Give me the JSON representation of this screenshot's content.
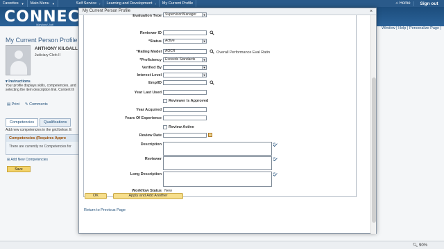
{
  "topnav": {
    "menus": [
      "Favorites",
      "Main Menu",
      "Self Service",
      "Learning and Development",
      "My Current Profile"
    ],
    "home": "Home",
    "signout": "Sign out"
  },
  "banner": {
    "logo": "CONNEC",
    "sub": "Maryland Judi"
  },
  "background": {
    "links": "Window | Help | Personalize Page |",
    "title": "My Current Person Profile",
    "name": "ANTHONY KILGALL",
    "job": "Judiciary Clerk II",
    "instructions_heading": "Instructions",
    "instructions_text": "Your profile displays skills, competencies, and selecting the item description link. Content th",
    "print": "Print",
    "comments": "Comments",
    "tabs": [
      "Competencies",
      "Qualifications"
    ],
    "help": "Add new competencies in the grid below. E",
    "section_heading": "Competencies (Requires Appro",
    "section_text": "There are currently no Competencies for",
    "add_link": "Add New Competencies",
    "save": "Save"
  },
  "statusbar": {
    "zoom": "90%"
  },
  "modal": {
    "title": "My Current Person Profile",
    "close": "×",
    "cut_label": "Evaluation Type",
    "cut_value": "Supervisor/Manager",
    "fields": {
      "reviewer_id_label": "Reviewer ID",
      "status_label": "*Status",
      "status_value": "Active",
      "rating_model_label": "*Rating Model",
      "rating_model_value": "AOCR",
      "rating_model_desc": "Overall Performance Eval Ratin",
      "proficiency_label": "*Proficiency",
      "proficiency_value": "Exceeds Standards",
      "verified_by_label": "Verified By",
      "verified_by_value": "",
      "interest_level_label": "Interest Level",
      "interest_level_value": "",
      "emplid_label": "EmplID",
      "emplid_value": "",
      "year_last_used_label": "Year Last Used",
      "year_last_used_value": "",
      "reviewer_is_approved_label": "Reviewer Is Approved",
      "year_acquired_label": "Year Acquired",
      "year_acquired_value": "",
      "years_of_experience_label": "Years Of Experience",
      "years_of_experience_value": "",
      "review_active_label": "Review Active",
      "review_date_label": "Review Date",
      "review_date_value": "",
      "description_label": "Description",
      "reviewer_label": "Reviewer",
      "long_description_label": "Long Description",
      "workflow_status_label": "Workflow Status",
      "workflow_status_value": "New"
    },
    "buttons": {
      "ok": "OK",
      "apply_add": "Apply and Add Another"
    },
    "return_link": "Return to Previous Page"
  }
}
